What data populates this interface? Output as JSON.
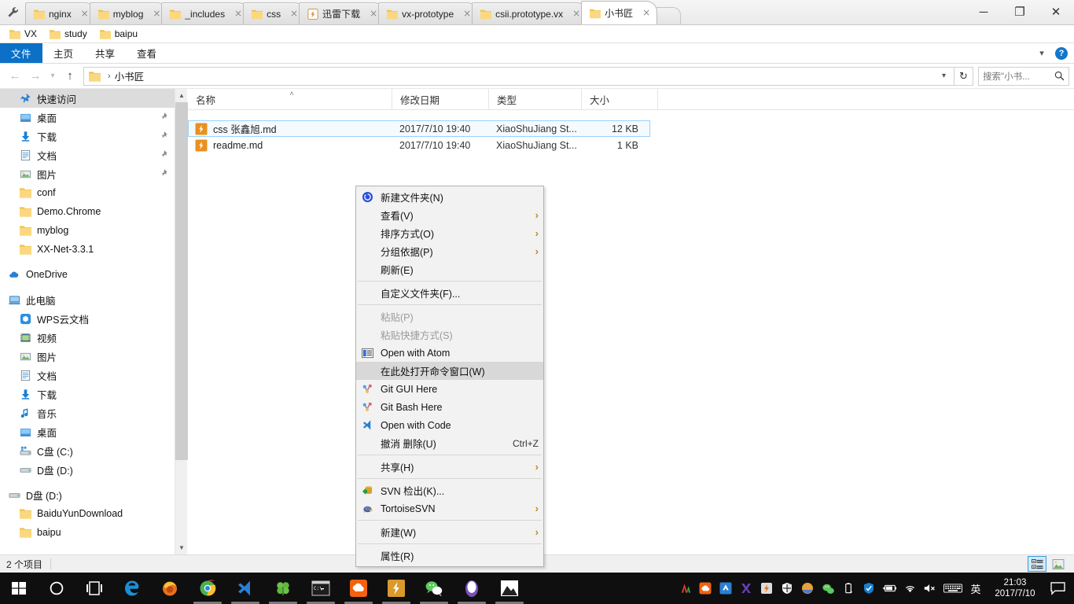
{
  "window": {
    "tab_manager_icon": "wrench-icon",
    "tabs": [
      {
        "label": "nginx",
        "icon": "folder-icon",
        "active": false,
        "close": "×"
      },
      {
        "label": "myblog",
        "icon": "folder-icon",
        "active": false,
        "close": "×"
      },
      {
        "label": "_includes",
        "icon": "folder-icon",
        "active": false,
        "close": "×"
      },
      {
        "label": "css",
        "icon": "folder-icon",
        "active": false,
        "close": "×"
      },
      {
        "label": "迅雷下载",
        "icon": "thunder-download-icon",
        "active": false,
        "close": "×"
      },
      {
        "label": "vx-prototype",
        "icon": "folder-icon",
        "active": false,
        "close": "×"
      },
      {
        "label": "csii.prototype.vx",
        "icon": "folder-icon",
        "active": false,
        "close": "×"
      },
      {
        "label": "小书匠",
        "icon": "folder-icon",
        "active": true,
        "close": "×"
      }
    ],
    "controls": {
      "minimize": "─",
      "maximize": "❐",
      "close": "✕"
    }
  },
  "shortcut_bar": {
    "items": [
      {
        "label": "VX",
        "icon": "folder-icon"
      },
      {
        "label": "study",
        "icon": "folder-icon"
      },
      {
        "label": "baipu",
        "icon": "folder-icon"
      }
    ]
  },
  "ribbon": {
    "file_tab": "文件",
    "tabs": [
      {
        "label": "主页"
      },
      {
        "label": "共享"
      },
      {
        "label": "查看"
      }
    ],
    "collapse_icon": "chevron-down-icon",
    "help_label": "?"
  },
  "address_bar": {
    "back_icon": "arrow-left-icon",
    "forward_icon": "arrow-right-icon",
    "recent_icon": "chevron-down-icon",
    "up_icon": "arrow-up-icon",
    "breadcrumb": {
      "folder_icon": "folder-icon",
      "separator": "›",
      "path": "小书匠"
    },
    "dropdown_icon": "chevron-down-icon",
    "refresh_icon": "refresh-icon",
    "search_placeholder": "搜索\"小书...",
    "search_icon": "search-icon"
  },
  "sidebar": {
    "groups": [
      {
        "header": {
          "label": "快速访问",
          "icon": "pin-star-icon",
          "selected": true,
          "expander": ""
        },
        "items": [
          {
            "label": "桌面",
            "icon": "desktop-icon",
            "pinned": true
          },
          {
            "label": "下载",
            "icon": "download-icon",
            "pinned": true
          },
          {
            "label": "文档",
            "icon": "document-icon",
            "pinned": true
          },
          {
            "label": "图片",
            "icon": "picture-icon",
            "pinned": true
          },
          {
            "label": "conf",
            "icon": "folder-icon",
            "pinned": false
          },
          {
            "label": "Demo.Chrome",
            "icon": "folder-icon",
            "pinned": false
          },
          {
            "label": "myblog",
            "icon": "folder-icon",
            "pinned": false
          },
          {
            "label": "XX-Net-3.3.1",
            "icon": "folder-icon",
            "pinned": false
          }
        ]
      },
      {
        "header": {
          "label": "OneDrive",
          "icon": "onedrive-icon",
          "selected": false
        },
        "items": []
      },
      {
        "header": {
          "label": "此电脑",
          "icon": "this-pc-icon",
          "selected": false
        },
        "items": [
          {
            "label": "WPS云文档",
            "icon": "wps-cloud-icon",
            "pinned": false
          },
          {
            "label": "视频",
            "icon": "video-icon",
            "pinned": false
          },
          {
            "label": "图片",
            "icon": "picture-icon",
            "pinned": false
          },
          {
            "label": "文档",
            "icon": "document-icon",
            "pinned": false
          },
          {
            "label": "下载",
            "icon": "download-icon",
            "pinned": false
          },
          {
            "label": "音乐",
            "icon": "music-icon",
            "pinned": false
          },
          {
            "label": "桌面",
            "icon": "desktop-icon",
            "pinned": false
          },
          {
            "label": "C盘 (C:)",
            "icon": "system-drive-icon",
            "pinned": false
          },
          {
            "label": "D盘 (D:)",
            "icon": "drive-icon",
            "pinned": false
          }
        ]
      },
      {
        "header": {
          "label": "D盘 (D:)",
          "icon": "drive-icon",
          "selected": false
        },
        "items": [
          {
            "label": "BaiduYunDownload",
            "icon": "folder-icon",
            "pinned": false
          },
          {
            "label": "baipu",
            "icon": "folder-icon",
            "pinned": false
          }
        ]
      }
    ],
    "scroll_up_icon": "chevron-up-icon",
    "scroll_down_icon": "chevron-down-icon"
  },
  "file_list": {
    "columns": [
      {
        "label": "名称",
        "sorted": true,
        "sort_icon": "˄"
      },
      {
        "label": "修改日期",
        "sorted": false
      },
      {
        "label": "类型",
        "sorted": false
      },
      {
        "label": "大小",
        "sorted": false,
        "align": "right"
      }
    ],
    "rows": [
      {
        "name": "css 张鑫旭.md",
        "icon": "xiaoshujiang-file-icon",
        "modified": "2017/7/10 19:40",
        "type": "XiaoShuJiang St...",
        "size": "12 KB",
        "selected": true
      },
      {
        "name": "readme.md",
        "icon": "xiaoshujiang-file-icon",
        "modified": "2017/7/10 19:40",
        "type": "XiaoShuJiang St...",
        "size": "1 KB",
        "selected": false
      }
    ]
  },
  "context_menu": {
    "items": [
      {
        "label": "新建文件夹(N)",
        "icon": "new-folder-icon",
        "type": "item"
      },
      {
        "label": "查看(V)",
        "icon": null,
        "type": "submenu"
      },
      {
        "label": "排序方式(O)",
        "icon": null,
        "type": "submenu"
      },
      {
        "label": "分组依据(P)",
        "icon": null,
        "type": "submenu"
      },
      {
        "label": "刷新(E)",
        "icon": null,
        "type": "item"
      },
      {
        "type": "separator"
      },
      {
        "label": "自定义文件夹(F)...",
        "icon": null,
        "type": "item"
      },
      {
        "type": "separator"
      },
      {
        "label": "粘贴(P)",
        "icon": null,
        "type": "item",
        "disabled": true
      },
      {
        "label": "粘贴快捷方式(S)",
        "icon": null,
        "type": "item",
        "disabled": true
      },
      {
        "label": "Open with Atom",
        "icon": "atom-icon",
        "type": "item"
      },
      {
        "label": "在此处打开命令窗口(W)",
        "icon": null,
        "type": "item",
        "highlighted": true
      },
      {
        "label": "Git GUI Here",
        "icon": "git-icon",
        "type": "item"
      },
      {
        "label": "Git Bash Here",
        "icon": "git-icon",
        "type": "item"
      },
      {
        "label": "Open with Code",
        "icon": "vscode-icon",
        "type": "item"
      },
      {
        "label": "撤消 删除(U)",
        "icon": null,
        "type": "item",
        "accel": "Ctrl+Z"
      },
      {
        "type": "separator"
      },
      {
        "label": "共享(H)",
        "icon": null,
        "type": "submenu"
      },
      {
        "type": "separator"
      },
      {
        "label": "SVN 检出(K)...",
        "icon": "svn-checkout-icon",
        "type": "item"
      },
      {
        "label": "TortoiseSVN",
        "icon": "tortoise-icon",
        "type": "submenu"
      },
      {
        "type": "separator"
      },
      {
        "label": "新建(W)",
        "icon": null,
        "type": "submenu"
      },
      {
        "type": "separator"
      },
      {
        "label": "属性(R)",
        "icon": null,
        "type": "item"
      }
    ],
    "submenu_arrow": "›"
  },
  "status_bar": {
    "item_count": "2 个项目",
    "view_buttons": [
      {
        "name": "details-view",
        "icon": "details-view-icon",
        "active": true
      },
      {
        "name": "large-icons-view",
        "icon": "large-icons-view-icon",
        "active": false
      }
    ]
  },
  "taskbar": {
    "start_icon": "windows-start-icon",
    "cortana_icon": "cortana-circle-icon",
    "taskview_icon": "task-view-icon",
    "pinned": [
      {
        "name": "edge-icon",
        "running": false
      },
      {
        "name": "firefox-icon",
        "running": false
      },
      {
        "name": "chrome-icon",
        "running": true
      },
      {
        "name": "visual-studio-code-icon",
        "running": true
      },
      {
        "name": "clover-clover-icon",
        "running": true
      },
      {
        "name": "cmd-console-icon",
        "running": true
      },
      {
        "name": "baidu-netdisk-icon",
        "running": true
      },
      {
        "name": "xiaoshujiang-icon",
        "running": true
      },
      {
        "name": "wechat-icon",
        "running": true
      },
      {
        "name": "egg-app-icon",
        "running": true
      },
      {
        "name": "photos-icon",
        "running": true
      }
    ],
    "tray": [
      {
        "name": "kingsoft-icon"
      },
      {
        "name": "baidu-netdisk-tray-icon"
      },
      {
        "name": "wps-icon"
      },
      {
        "name": "xmind-icon"
      },
      {
        "name": "thunder-icon"
      },
      {
        "name": "windows-defender-icon"
      },
      {
        "name": "sogou-weather-icon"
      },
      {
        "name": "wechat-tray-icon"
      },
      {
        "name": "usb-eject-icon"
      },
      {
        "name": "security-shield-icon"
      },
      {
        "name": "battery-icon"
      },
      {
        "name": "wifi-icon"
      },
      {
        "name": "volume-muted-icon"
      },
      {
        "name": "touch-keyboard-icon"
      }
    ],
    "ime_label": "英",
    "clock": {
      "time": "21:03",
      "date": "2017/7/10"
    },
    "action_center_icon": "action-center-icon"
  },
  "colors": {
    "accent": "#0c70c7",
    "selection": "#cde8ff",
    "folder": "#f7d074",
    "taskbar": "#0f0f10",
    "menu_bg": "#f2f2f2",
    "highlight": "#d8d8d8"
  }
}
